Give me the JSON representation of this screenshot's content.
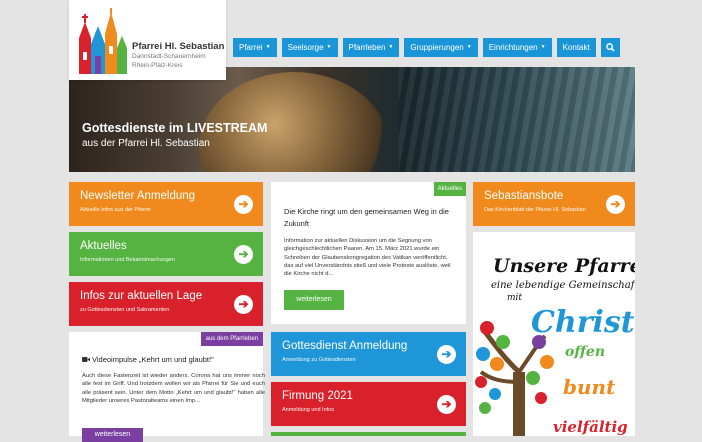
{
  "logo": {
    "title": "Pfarrei Hl. Sebastian",
    "line2": "Dannstadt-Schauernheim",
    "line3": "Rhein-Pfalz-Kreis"
  },
  "nav": {
    "items": [
      {
        "label": "Pfarrei"
      },
      {
        "label": "Seelsorge"
      },
      {
        "label": "Pfarrleben"
      },
      {
        "label": "Gruppierungen"
      },
      {
        "label": "Einrichtungen"
      },
      {
        "label": "Kontakt"
      }
    ],
    "caret": "▼",
    "search_icon": "search-icon"
  },
  "hero": {
    "title": "Gottesdienste im LIVESTREAM",
    "subtitle": "aus der Pfarrei Hl. Sebastian"
  },
  "tiles": {
    "newsletter": {
      "title": "Newsletter Anmeldung",
      "subtitle": "Aktuelle Infos aus der Pfarrei",
      "color": "#f08a1c"
    },
    "aktuelles": {
      "title": "Aktuelles",
      "subtitle": "Informationen und Bekanntmachungen",
      "color": "#54b341"
    },
    "infos": {
      "title": "Infos zur aktuellen Lage",
      "subtitle": "zu Gottesdiensten und Sakramenten",
      "color": "#d9212b"
    },
    "sebastiansbote": {
      "title": "Sebastiansbote",
      "subtitle": "Das Kirchenblatt der Pfarrei Hl. Sebastian",
      "color": "#f08a1c"
    },
    "gottesdienst": {
      "title": "Gottesdienst Anmeldung",
      "subtitle": "Anmeldung zu Gottesdiensten",
      "color": "#1e96d7"
    },
    "firmung": {
      "title": "Firmung 2021",
      "subtitle": "Anmeldung und Infos",
      "color": "#d9212b"
    }
  },
  "arrow_glyph": "➔",
  "news_card": {
    "badge": "Aktuelles",
    "title": "Die Kirche ringt um den gemeinsamen Weg in die Zukunft",
    "body": "Information zur aktuellen Diskussion um die Segnung von gleichgeschlechtlichen Paaren. Am 15. März 2021 wurde ein Schreiben der Glaubenskongregation des Vatikan veröffentlicht, das auf viel Unverständnis stieß und viele Proteste auslöste, weil die Kirche nicht d...",
    "button": "weiterlesen"
  },
  "impulse_card": {
    "badge": "aus dem Pfarrleben",
    "title": "Videoimpulse „Kehrt um und glaubt!\"",
    "body": "Auch diese Fastenzeit ist wieder anders. Corona hat uns immer noch alle fest im Griff. Und trotzdem wollen wir als Pfarrei für Sie und euch alle präsent sein. Unter dem Motto „Kehrt um und glaubt!\" haben alle Mitglieder unseres Pastoralteams einen Imp...",
    "button": "weiterlesen"
  },
  "poster": {
    "line1": "Unsere Pfarrei –",
    "line2": "eine lebendige Gemeinschaft",
    "line3": "mit",
    "word": "Christus",
    "w_offen": "offen",
    "w_bunt": "bunt",
    "w_vielfaeltig": "vielfältig"
  },
  "colors": {
    "blue": "#1a96d8",
    "orange": "#f08a1c",
    "green": "#54b341",
    "red": "#d9212b",
    "purple": "#7a3fa0"
  }
}
